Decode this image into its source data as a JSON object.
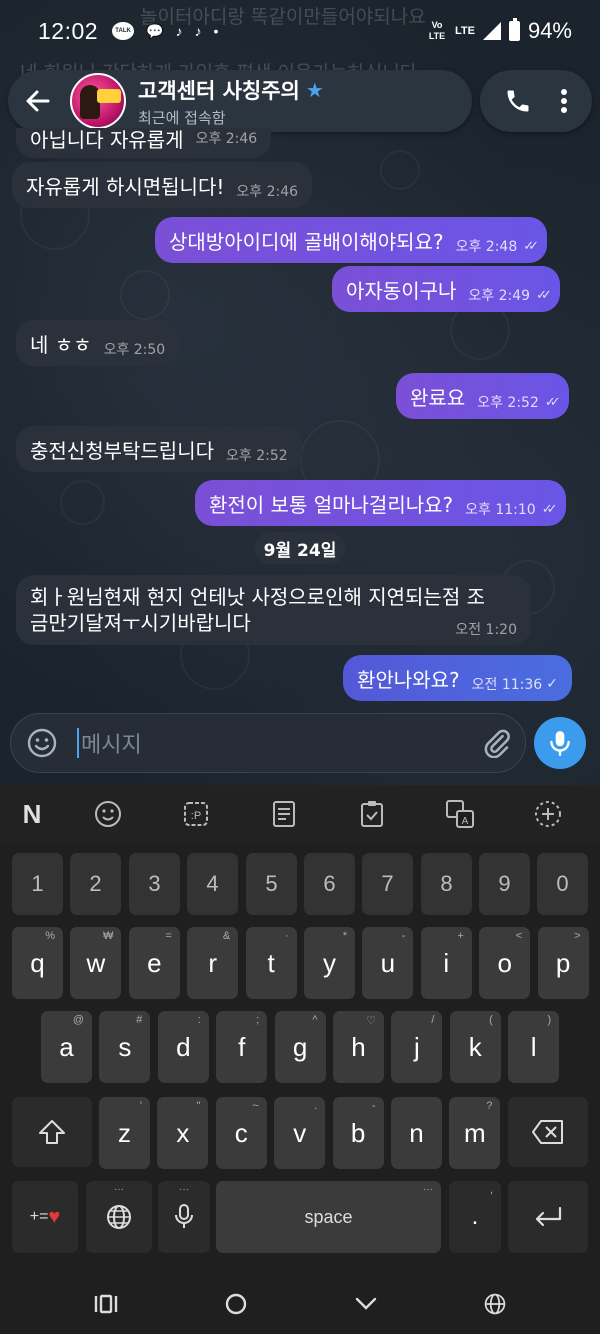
{
  "status_bar": {
    "time": "12:02",
    "talk_label": "TALK",
    "volte": "Vo LTE",
    "lte": "LTE",
    "battery": "94%"
  },
  "ghost": {
    "line1": "놀이터아디랑 똑같이만들어야되나요",
    "line2": "네 회원님 간단하게 가입후 평생 이용가능하십니다"
  },
  "header": {
    "title": "고객센터 사칭주의",
    "subtitle": "최근에 접속함"
  },
  "messages": [
    {
      "text": "아닙니다 자유롭게",
      "time": "오후 2:46",
      "dir": "in"
    },
    {
      "text": "자유롭게 하시면됩니다!",
      "time": "오후 2:46",
      "dir": "in"
    },
    {
      "text": "상대방아이디에 골배이해야되요?",
      "time": "오후 2:48",
      "dir": "out"
    },
    {
      "text": "아자동이구나",
      "time": "오후 2:49",
      "dir": "out"
    },
    {
      "text": "네 ㅎㅎ",
      "time": "오후 2:50",
      "dir": "in"
    },
    {
      "text": "완료요",
      "time": "오후 2:52",
      "dir": "out"
    },
    {
      "text": "충전신청부탁드립니다",
      "time": "오후 2:52",
      "dir": "in"
    },
    {
      "text": "환전이 보통 얼마나걸리나요?",
      "time": "오후 11:10",
      "dir": "out"
    },
    {
      "text_line1": "회ㅏ원님현재 현지 언테낫 사정으로인해 지연되는점 조",
      "text_line2": "금만기달져ㅜ시기바랍니다",
      "time": "오전 1:20",
      "dir": "in"
    },
    {
      "text": "환안나와요?",
      "time": "오전 11:36",
      "dir": "out"
    }
  ],
  "date_divider": "9월 24일",
  "input": {
    "placeholder": "메시지"
  },
  "keyboard": {
    "number_row": [
      "1",
      "2",
      "3",
      "4",
      "5",
      "6",
      "7",
      "8",
      "9",
      "0"
    ],
    "row1": [
      {
        "key": "q",
        "hint": "%"
      },
      {
        "key": "w",
        "hint": "₩"
      },
      {
        "key": "e",
        "hint": "="
      },
      {
        "key": "r",
        "hint": "&"
      },
      {
        "key": "t",
        "hint": "·"
      },
      {
        "key": "y",
        "hint": "*"
      },
      {
        "key": "u",
        "hint": "-"
      },
      {
        "key": "i",
        "hint": "+"
      },
      {
        "key": "o",
        "hint": "<"
      },
      {
        "key": "p",
        "hint": ">"
      }
    ],
    "row2": [
      {
        "key": "a",
        "hint": "@"
      },
      {
        "key": "s",
        "hint": "#"
      },
      {
        "key": "d",
        "hint": ":"
      },
      {
        "key": "f",
        "hint": ";"
      },
      {
        "key": "g",
        "hint": "^"
      },
      {
        "key": "h",
        "hint": "♡"
      },
      {
        "key": "j",
        "hint": "/"
      },
      {
        "key": "k",
        "hint": "("
      },
      {
        "key": "l",
        "hint": ")"
      }
    ],
    "row3": [
      {
        "key": "z",
        "hint": "'"
      },
      {
        "key": "x",
        "hint": "\""
      },
      {
        "key": "c",
        "hint": "~"
      },
      {
        "key": "v",
        "hint": "."
      },
      {
        "key": "b",
        "hint": "-"
      },
      {
        "key": "n",
        "hint": ""
      },
      {
        "key": "m",
        "hint": "?"
      }
    ],
    "special_label": "+=",
    "space_label": "space",
    "period_label": ".",
    "comma_hint": ","
  },
  "colors": {
    "accent_blue": "#3d9bed",
    "outgoing_purple": "#7b4fd6",
    "incoming_bubble": "#2a313a"
  }
}
